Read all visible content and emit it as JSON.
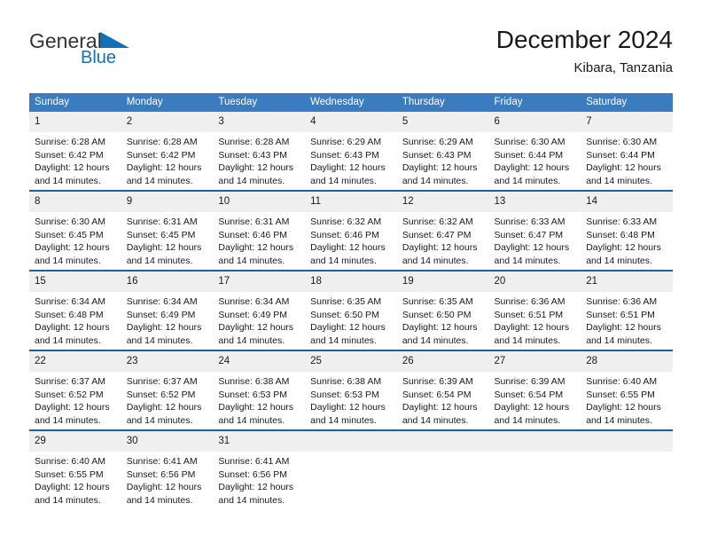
{
  "logo": {
    "word1": "General",
    "word2": "Blue",
    "triangle_color": "#1270b8"
  },
  "header": {
    "title": "December 2024",
    "subtitle": "Kibara, Tanzania",
    "header_bg": "#3b7cc0",
    "row_divider": "#1b5fa8",
    "daynum_bg": "#efefef"
  },
  "weekdays": [
    "Sunday",
    "Monday",
    "Tuesday",
    "Wednesday",
    "Thursday",
    "Friday",
    "Saturday"
  ],
  "labels": {
    "sunrise": "Sunrise:",
    "sunset": "Sunset:",
    "daylight_prefix": "Daylight:"
  },
  "weeks": [
    [
      {
        "day": "1",
        "sunrise": "Sunrise: 6:28 AM",
        "sunset": "Sunset: 6:42 PM",
        "daylight": "Daylight: 12 hours and 14 minutes."
      },
      {
        "day": "2",
        "sunrise": "Sunrise: 6:28 AM",
        "sunset": "Sunset: 6:42 PM",
        "daylight": "Daylight: 12 hours and 14 minutes."
      },
      {
        "day": "3",
        "sunrise": "Sunrise: 6:28 AM",
        "sunset": "Sunset: 6:43 PM",
        "daylight": "Daylight: 12 hours and 14 minutes."
      },
      {
        "day": "4",
        "sunrise": "Sunrise: 6:29 AM",
        "sunset": "Sunset: 6:43 PM",
        "daylight": "Daylight: 12 hours and 14 minutes."
      },
      {
        "day": "5",
        "sunrise": "Sunrise: 6:29 AM",
        "sunset": "Sunset: 6:43 PM",
        "daylight": "Daylight: 12 hours and 14 minutes."
      },
      {
        "day": "6",
        "sunrise": "Sunrise: 6:30 AM",
        "sunset": "Sunset: 6:44 PM",
        "daylight": "Daylight: 12 hours and 14 minutes."
      },
      {
        "day": "7",
        "sunrise": "Sunrise: 6:30 AM",
        "sunset": "Sunset: 6:44 PM",
        "daylight": "Daylight: 12 hours and 14 minutes."
      }
    ],
    [
      {
        "day": "8",
        "sunrise": "Sunrise: 6:30 AM",
        "sunset": "Sunset: 6:45 PM",
        "daylight": "Daylight: 12 hours and 14 minutes."
      },
      {
        "day": "9",
        "sunrise": "Sunrise: 6:31 AM",
        "sunset": "Sunset: 6:45 PM",
        "daylight": "Daylight: 12 hours and 14 minutes."
      },
      {
        "day": "10",
        "sunrise": "Sunrise: 6:31 AM",
        "sunset": "Sunset: 6:46 PM",
        "daylight": "Daylight: 12 hours and 14 minutes."
      },
      {
        "day": "11",
        "sunrise": "Sunrise: 6:32 AM",
        "sunset": "Sunset: 6:46 PM",
        "daylight": "Daylight: 12 hours and 14 minutes."
      },
      {
        "day": "12",
        "sunrise": "Sunrise: 6:32 AM",
        "sunset": "Sunset: 6:47 PM",
        "daylight": "Daylight: 12 hours and 14 minutes."
      },
      {
        "day": "13",
        "sunrise": "Sunrise: 6:33 AM",
        "sunset": "Sunset: 6:47 PM",
        "daylight": "Daylight: 12 hours and 14 minutes."
      },
      {
        "day": "14",
        "sunrise": "Sunrise: 6:33 AM",
        "sunset": "Sunset: 6:48 PM",
        "daylight": "Daylight: 12 hours and 14 minutes."
      }
    ],
    [
      {
        "day": "15",
        "sunrise": "Sunrise: 6:34 AM",
        "sunset": "Sunset: 6:48 PM",
        "daylight": "Daylight: 12 hours and 14 minutes."
      },
      {
        "day": "16",
        "sunrise": "Sunrise: 6:34 AM",
        "sunset": "Sunset: 6:49 PM",
        "daylight": "Daylight: 12 hours and 14 minutes."
      },
      {
        "day": "17",
        "sunrise": "Sunrise: 6:34 AM",
        "sunset": "Sunset: 6:49 PM",
        "daylight": "Daylight: 12 hours and 14 minutes."
      },
      {
        "day": "18",
        "sunrise": "Sunrise: 6:35 AM",
        "sunset": "Sunset: 6:50 PM",
        "daylight": "Daylight: 12 hours and 14 minutes."
      },
      {
        "day": "19",
        "sunrise": "Sunrise: 6:35 AM",
        "sunset": "Sunset: 6:50 PM",
        "daylight": "Daylight: 12 hours and 14 minutes."
      },
      {
        "day": "20",
        "sunrise": "Sunrise: 6:36 AM",
        "sunset": "Sunset: 6:51 PM",
        "daylight": "Daylight: 12 hours and 14 minutes."
      },
      {
        "day": "21",
        "sunrise": "Sunrise: 6:36 AM",
        "sunset": "Sunset: 6:51 PM",
        "daylight": "Daylight: 12 hours and 14 minutes."
      }
    ],
    [
      {
        "day": "22",
        "sunrise": "Sunrise: 6:37 AM",
        "sunset": "Sunset: 6:52 PM",
        "daylight": "Daylight: 12 hours and 14 minutes."
      },
      {
        "day": "23",
        "sunrise": "Sunrise: 6:37 AM",
        "sunset": "Sunset: 6:52 PM",
        "daylight": "Daylight: 12 hours and 14 minutes."
      },
      {
        "day": "24",
        "sunrise": "Sunrise: 6:38 AM",
        "sunset": "Sunset: 6:53 PM",
        "daylight": "Daylight: 12 hours and 14 minutes."
      },
      {
        "day": "25",
        "sunrise": "Sunrise: 6:38 AM",
        "sunset": "Sunset: 6:53 PM",
        "daylight": "Daylight: 12 hours and 14 minutes."
      },
      {
        "day": "26",
        "sunrise": "Sunrise: 6:39 AM",
        "sunset": "Sunset: 6:54 PM",
        "daylight": "Daylight: 12 hours and 14 minutes."
      },
      {
        "day": "27",
        "sunrise": "Sunrise: 6:39 AM",
        "sunset": "Sunset: 6:54 PM",
        "daylight": "Daylight: 12 hours and 14 minutes."
      },
      {
        "day": "28",
        "sunrise": "Sunrise: 6:40 AM",
        "sunset": "Sunset: 6:55 PM",
        "daylight": "Daylight: 12 hours and 14 minutes."
      }
    ],
    [
      {
        "day": "29",
        "sunrise": "Sunrise: 6:40 AM",
        "sunset": "Sunset: 6:55 PM",
        "daylight": "Daylight: 12 hours and 14 minutes."
      },
      {
        "day": "30",
        "sunrise": "Sunrise: 6:41 AM",
        "sunset": "Sunset: 6:56 PM",
        "daylight": "Daylight: 12 hours and 14 minutes."
      },
      {
        "day": "31",
        "sunrise": "Sunrise: 6:41 AM",
        "sunset": "Sunset: 6:56 PM",
        "daylight": "Daylight: 12 hours and 14 minutes."
      },
      {
        "day": "",
        "sunrise": "",
        "sunset": "",
        "daylight": ""
      },
      {
        "day": "",
        "sunrise": "",
        "sunset": "",
        "daylight": ""
      },
      {
        "day": "",
        "sunrise": "",
        "sunset": "",
        "daylight": ""
      },
      {
        "day": "",
        "sunrise": "",
        "sunset": "",
        "daylight": ""
      }
    ]
  ]
}
